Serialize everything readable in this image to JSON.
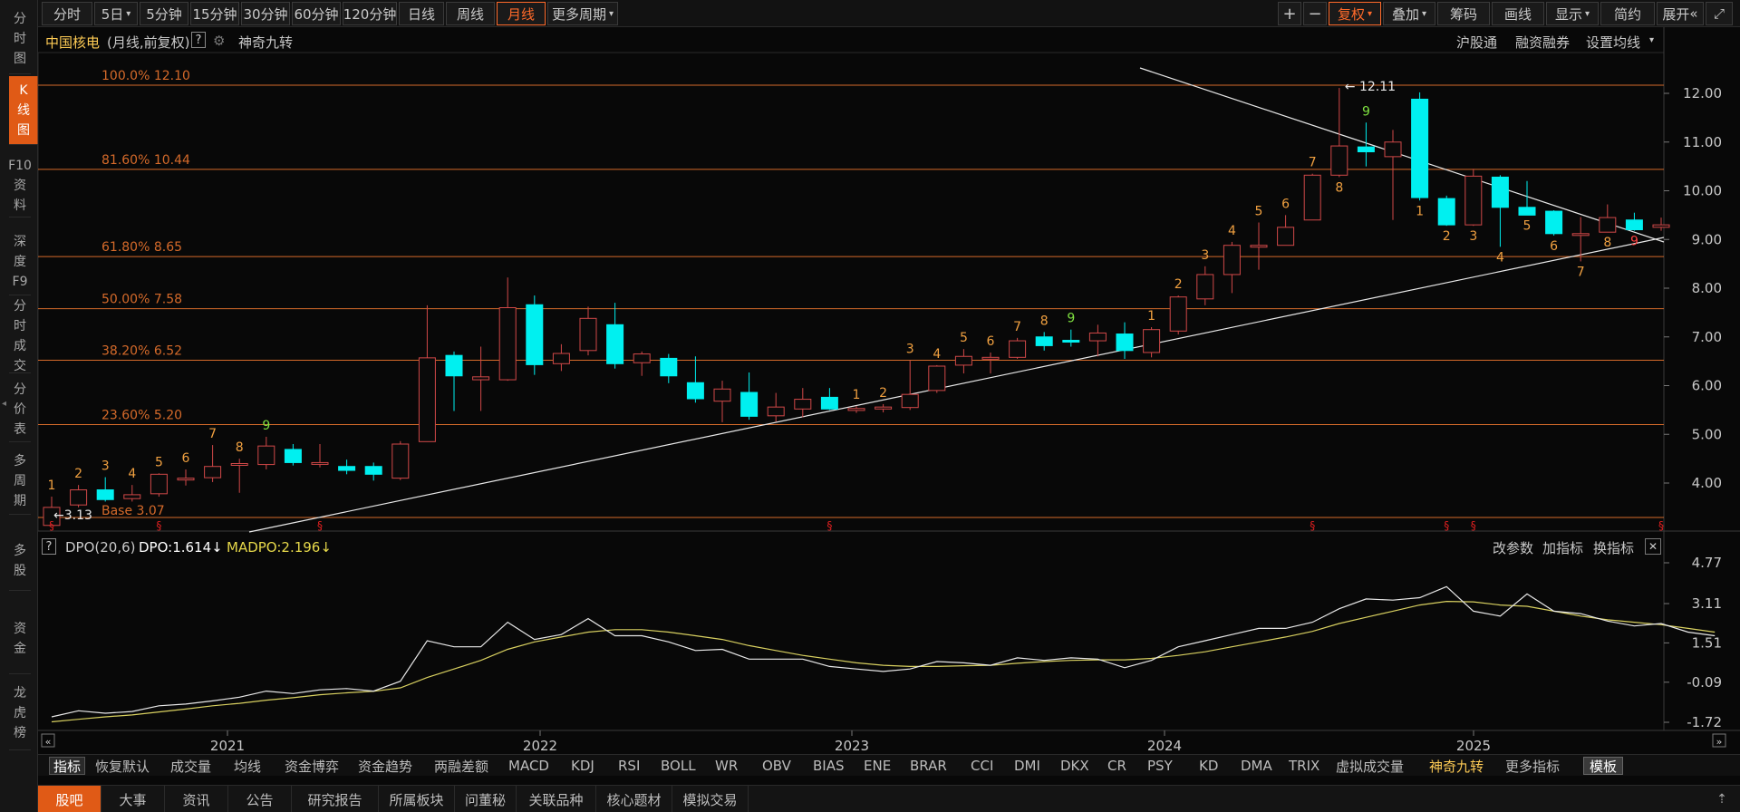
{
  "sidebar": {
    "items": [
      {
        "label": "分\n时\n图"
      },
      {
        "label": "K\n线\n图"
      },
      {
        "label": "F10\n资\n料"
      },
      {
        "label": "深\n度\nF9"
      },
      {
        "label": "分\n时\n成\n交"
      },
      {
        "label": "分\n价\n表"
      },
      {
        "label": "多\n周\n期"
      },
      {
        "label": "多\n股"
      },
      {
        "label": "资\n金"
      },
      {
        "label": "龙\n虎\n榜"
      }
    ]
  },
  "toolbar": {
    "periods": [
      "分时",
      "5日",
      "5分钟",
      "15分钟",
      "30分钟",
      "60分钟",
      "120分钟",
      "日线",
      "周线",
      "月线",
      "更多周期"
    ],
    "plus": "+",
    "minus": "−",
    "right_buttons": [
      "复权",
      "叠加",
      "筹码",
      "画线",
      "显示",
      "简约",
      "展开"
    ]
  },
  "header": {
    "stock_name": "中国核电",
    "mode": "(月线,前复权)",
    "help": "?",
    "indicator_name": "神奇九转",
    "right_links": [
      "沪股通",
      "融资融券",
      "设置均线"
    ]
  },
  "chart_data": {
    "type": "candlestick",
    "period": "monthly",
    "yticks": [
      "12.00",
      "11.00",
      "10.00",
      "9.00",
      "8.00",
      "7.00",
      "6.00",
      "5.00",
      "4.00"
    ],
    "ylim": [
      2.9,
      12.6
    ],
    "x_labels": [
      "2021",
      "2022",
      "2023",
      "2024",
      "2025"
    ],
    "fib_levels": [
      {
        "label": "100.0% 12.10",
        "value": 12.1
      },
      {
        "label": "81.60% 10.44",
        "value": 10.44
      },
      {
        "label": "61.80% 8.65",
        "value": 8.65
      },
      {
        "label": "50.00% 7.58",
        "value": 7.58
      },
      {
        "label": "38.20% 6.52",
        "value": 6.52
      },
      {
        "label": "23.60% 5.20",
        "value": 5.2
      }
    ],
    "base_label": "Base   3.07",
    "high_marker": "12.11",
    "low_marker": "3.13",
    "candles": [
      {
        "o": 3.13,
        "h": 3.72,
        "l": 3.13,
        "c": 3.5,
        "t": "1"
      },
      {
        "o": 3.55,
        "h": 3.96,
        "l": 3.5,
        "c": 3.86,
        "t": "2"
      },
      {
        "o": 3.86,
        "h": 4.12,
        "l": 3.62,
        "c": 3.66,
        "t": "3"
      },
      {
        "o": 3.68,
        "h": 3.96,
        "l": 3.62,
        "c": 3.76,
        "t": "4"
      },
      {
        "o": 3.78,
        "h": 4.2,
        "l": 3.72,
        "c": 4.18,
        "t": "5"
      },
      {
        "o": 4.08,
        "h": 4.28,
        "l": 3.95,
        "c": 4.1,
        "t": "6"
      },
      {
        "o": 4.11,
        "h": 4.78,
        "l": 4.02,
        "c": 4.34,
        "t": "7"
      },
      {
        "o": 4.38,
        "h": 4.5,
        "l": 3.8,
        "c": 4.4,
        "t": "8"
      },
      {
        "o": 4.38,
        "h": 4.95,
        "l": 4.28,
        "c": 4.76,
        "t": "9"
      },
      {
        "o": 4.69,
        "h": 4.8,
        "l": 4.36,
        "c": 4.42
      },
      {
        "o": 4.39,
        "h": 4.8,
        "l": 4.32,
        "c": 4.42
      },
      {
        "o": 4.34,
        "h": 4.48,
        "l": 4.18,
        "c": 4.26
      },
      {
        "o": 4.34,
        "h": 4.42,
        "l": 4.05,
        "c": 4.18
      },
      {
        "o": 4.1,
        "h": 4.86,
        "l": 4.06,
        "c": 4.8
      },
      {
        "o": 4.85,
        "h": 7.65,
        "l": 4.85,
        "c": 6.57
      },
      {
        "o": 6.62,
        "h": 6.7,
        "l": 5.48,
        "c": 6.2
      },
      {
        "o": 6.12,
        "h": 6.8,
        "l": 5.48,
        "c": 6.18
      },
      {
        "o": 6.12,
        "h": 8.22,
        "l": 6.1,
        "c": 7.6
      },
      {
        "o": 7.66,
        "h": 7.85,
        "l": 6.22,
        "c": 6.43
      },
      {
        "o": 6.45,
        "h": 6.85,
        "l": 6.3,
        "c": 6.66
      },
      {
        "o": 6.72,
        "h": 7.62,
        "l": 6.62,
        "c": 7.38
      },
      {
        "o": 7.25,
        "h": 7.7,
        "l": 6.35,
        "c": 6.45
      },
      {
        "o": 6.47,
        "h": 6.7,
        "l": 6.2,
        "c": 6.65
      },
      {
        "o": 6.56,
        "h": 6.65,
        "l": 6.05,
        "c": 6.2
      },
      {
        "o": 6.06,
        "h": 6.6,
        "l": 5.65,
        "c": 5.73
      },
      {
        "o": 5.68,
        "h": 6.1,
        "l": 5.25,
        "c": 5.93
      },
      {
        "o": 5.86,
        "h": 6.27,
        "l": 5.3,
        "c": 5.37
      },
      {
        "o": 5.38,
        "h": 5.85,
        "l": 5.26,
        "c": 5.56
      },
      {
        "o": 5.52,
        "h": 5.95,
        "l": 5.35,
        "c": 5.72
      },
      {
        "o": 5.76,
        "h": 5.95,
        "l": 5.5,
        "c": 5.52
      },
      {
        "o": 5.49,
        "h": 5.58,
        "l": 5.44,
        "c": 5.53,
        "t": "1"
      },
      {
        "o": 5.52,
        "h": 5.62,
        "l": 5.45,
        "c": 5.56,
        "t": "2"
      },
      {
        "o": 5.55,
        "h": 6.52,
        "l": 5.5,
        "c": 5.82,
        "t": "3"
      },
      {
        "o": 5.9,
        "h": 6.42,
        "l": 5.85,
        "c": 6.4,
        "t": "4"
      },
      {
        "o": 6.42,
        "h": 6.75,
        "l": 6.25,
        "c": 6.6,
        "t": "5"
      },
      {
        "o": 6.58,
        "h": 6.68,
        "l": 6.25,
        "c": 6.58,
        "t": "6"
      },
      {
        "o": 6.58,
        "h": 6.98,
        "l": 6.55,
        "c": 6.92,
        "t": "7"
      },
      {
        "o": 7.0,
        "h": 7.1,
        "l": 6.72,
        "c": 6.82,
        "t": "8"
      },
      {
        "o": 6.93,
        "h": 7.15,
        "l": 6.8,
        "c": 6.9,
        "t": "9"
      },
      {
        "o": 6.92,
        "h": 7.25,
        "l": 6.6,
        "c": 7.08
      },
      {
        "o": 7.06,
        "h": 7.3,
        "l": 6.55,
        "c": 6.72
      },
      {
        "o": 6.68,
        "h": 7.2,
        "l": 6.58,
        "c": 7.15,
        "t": "1"
      },
      {
        "o": 7.12,
        "h": 7.85,
        "l": 7.05,
        "c": 7.82,
        "t": "2"
      },
      {
        "o": 7.78,
        "h": 8.45,
        "l": 7.65,
        "c": 8.28,
        "t": "3"
      },
      {
        "o": 8.28,
        "h": 8.95,
        "l": 7.9,
        "c": 8.88,
        "t": "4"
      },
      {
        "o": 8.85,
        "h": 9.35,
        "l": 8.38,
        "c": 8.88,
        "t": "5"
      },
      {
        "o": 8.88,
        "h": 9.5,
        "l": 8.9,
        "c": 9.25,
        "t": "6"
      },
      {
        "o": 9.4,
        "h": 10.35,
        "l": 9.4,
        "c": 10.32,
        "t": "7"
      },
      {
        "o": 10.32,
        "h": 12.11,
        "l": 10.28,
        "c": 10.92,
        "t": "8"
      },
      {
        "o": 10.9,
        "h": 11.4,
        "l": 10.5,
        "c": 10.8,
        "t": "9"
      },
      {
        "o": 10.7,
        "h": 11.25,
        "l": 9.4,
        "c": 11.0
      },
      {
        "o": 11.88,
        "h": 12.02,
        "l": 9.8,
        "c": 9.86,
        "t": "1"
      },
      {
        "o": 9.84,
        "h": 9.9,
        "l": 9.28,
        "c": 9.3,
        "t": "2"
      },
      {
        "o": 9.3,
        "h": 10.45,
        "l": 9.28,
        "c": 10.3,
        "t": "3"
      },
      {
        "o": 10.28,
        "h": 10.32,
        "l": 8.85,
        "c": 9.66,
        "t": "4"
      },
      {
        "o": 9.66,
        "h": 10.2,
        "l": 9.5,
        "c": 9.5,
        "t": "5"
      },
      {
        "o": 9.58,
        "h": 9.6,
        "l": 9.08,
        "c": 9.12,
        "t": "6"
      },
      {
        "o": 9.1,
        "h": 9.46,
        "l": 8.55,
        "c": 9.12,
        "t": "7"
      },
      {
        "o": 9.15,
        "h": 9.72,
        "l": 9.15,
        "c": 9.45,
        "t": "8"
      },
      {
        "o": 9.4,
        "h": 9.55,
        "l": 9.18,
        "c": 9.2,
        "t": "9"
      },
      {
        "o": 9.25,
        "h": 9.45,
        "l": 9.18,
        "c": 9.3
      }
    ]
  },
  "dpo": {
    "title": "DPO(20,6)",
    "dpo_label": "DPO:1.614",
    "madpo_label": "MADPO:2.196",
    "yticks": [
      "4.77",
      "3.11",
      "1.51",
      "-0.09",
      "-1.72"
    ],
    "ylim": [
      -1.72,
      4.77
    ],
    "dpo_values": [
      -1.5,
      -1.25,
      -1.35,
      -1.28,
      -1.05,
      -0.98,
      -0.85,
      -0.7,
      -0.45,
      -0.55,
      -0.4,
      -0.35,
      -0.45,
      -0.05,
      1.6,
      1.35,
      1.35,
      2.35,
      1.65,
      1.85,
      2.5,
      1.8,
      1.8,
      1.55,
      1.2,
      1.25,
      0.85,
      0.85,
      0.85,
      0.55,
      0.45,
      0.35,
      0.45,
      0.75,
      0.7,
      0.6,
      0.9,
      0.8,
      0.9,
      0.85,
      0.5,
      0.8,
      1.35,
      1.6,
      1.85,
      2.1,
      2.1,
      2.35,
      2.9,
      3.3,
      3.25,
      3.35,
      3.8,
      2.8,
      2.6,
      3.5,
      2.8,
      2.7,
      2.4,
      2.2,
      2.3,
      1.95,
      1.8
    ],
    "madpo_values": [
      -1.7,
      -1.6,
      -1.5,
      -1.42,
      -1.3,
      -1.18,
      -1.05,
      -0.95,
      -0.82,
      -0.72,
      -0.6,
      -0.52,
      -0.46,
      -0.32,
      0.1,
      0.45,
      0.8,
      1.25,
      1.55,
      1.75,
      1.95,
      2.05,
      2.05,
      1.95,
      1.8,
      1.65,
      1.4,
      1.2,
      1.0,
      0.85,
      0.7,
      0.6,
      0.55,
      0.55,
      0.58,
      0.6,
      0.68,
      0.75,
      0.8,
      0.82,
      0.82,
      0.88,
      1.0,
      1.15,
      1.35,
      1.55,
      1.75,
      1.98,
      2.3,
      2.55,
      2.8,
      3.05,
      3.2,
      3.18,
      3.05,
      3.0,
      2.8,
      2.6,
      2.45,
      2.35,
      2.25,
      2.1,
      1.95
    ],
    "right_links": [
      "改参数",
      "加指标",
      "换指标"
    ]
  },
  "indicator_tabs": [
    "指标",
    "恢复默认",
    "成交量",
    "均线",
    "资金博弈",
    "资金趋势",
    "两融差额",
    "MACD",
    "KDJ",
    "RSI",
    "BOLL",
    "WR",
    "OBV",
    "BIAS",
    "ENE",
    "BRAR",
    "CCI",
    "DMI",
    "DKX",
    "CR",
    "PSY",
    "KD",
    "DMA",
    "TRIX",
    "虚拟成交量",
    "神奇九转",
    "更多指标",
    "模板"
  ],
  "news_tabs": [
    "股吧",
    "大事",
    "资讯",
    "公告",
    "研究报告",
    "所属板块",
    "问董秘",
    "关联品种",
    "核心题材",
    "模拟交易"
  ],
  "colors": {
    "up": "#ff5050",
    "down": "#00f0f0",
    "fib": "#d56a2a",
    "dpo": "#e8e8e8",
    "madpo": "#d8d060"
  }
}
